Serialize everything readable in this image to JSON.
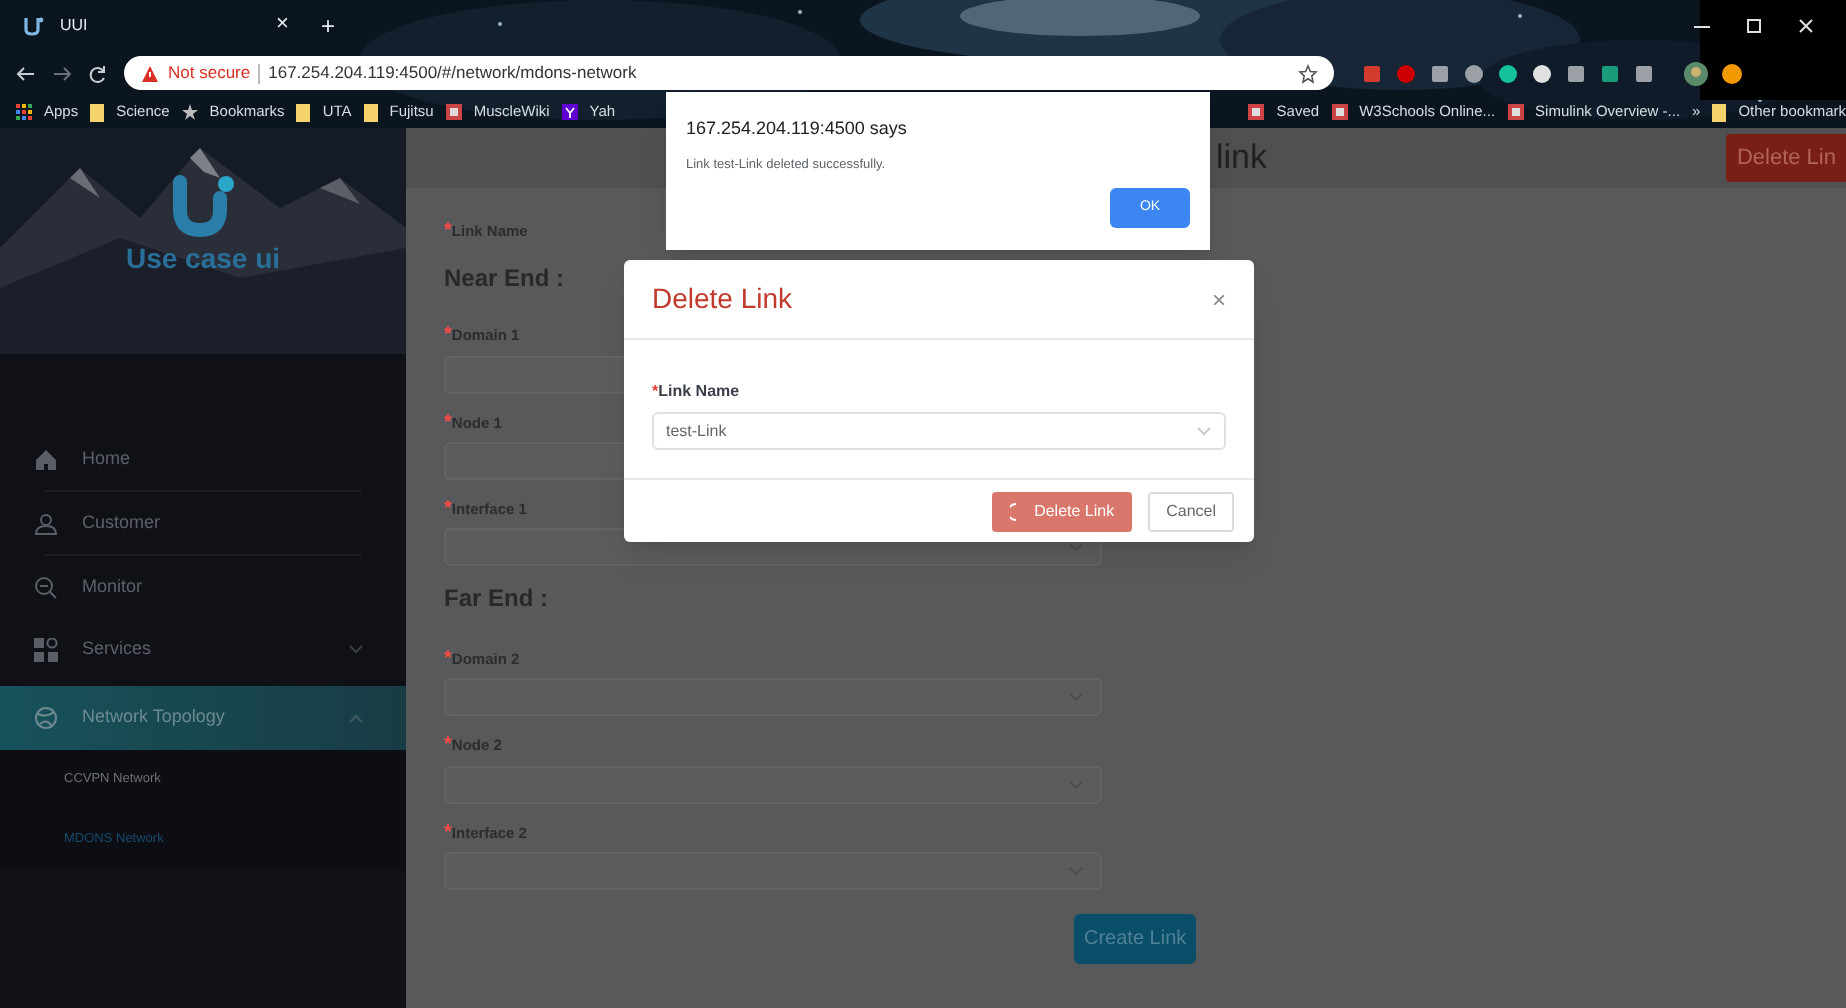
{
  "browser": {
    "tab": {
      "title": "UUI",
      "close": "×",
      "new_tab": "+"
    },
    "address": {
      "security": "Not secure",
      "url": "167.254.204.119:4500/#/network/mdons-network"
    },
    "bookmarks_left": [
      {
        "kind": "apps",
        "label": "Apps"
      },
      {
        "kind": "folder",
        "label": "Science"
      },
      {
        "kind": "star",
        "label": "Bookmarks"
      },
      {
        "kind": "folder",
        "label": "UTA"
      },
      {
        "kind": "folder",
        "label": "Fujitsu"
      },
      {
        "kind": "site",
        "label": "MuscleWiki"
      },
      {
        "kind": "yahoo",
        "label": "Yah"
      }
    ],
    "bookmarks_right": [
      {
        "kind": "site",
        "label": "Saved"
      },
      {
        "kind": "site",
        "label": "W3Schools Online..."
      },
      {
        "kind": "site",
        "label": "Simulink Overview -..."
      },
      {
        "kind": "more",
        "label": "»"
      },
      {
        "kind": "folder",
        "label": "Other bookmark"
      }
    ]
  },
  "sidebar": {
    "logo_text": "Use case ui",
    "menu": [
      {
        "kind": "home",
        "label": "Home",
        "selected": false
      },
      {
        "kind": "customer",
        "label": "Customer",
        "selected": false
      },
      {
        "kind": "monitor",
        "label": "Monitor",
        "selected": false
      },
      {
        "kind": "services",
        "label": "Services",
        "selected": false,
        "expanded": false
      },
      {
        "kind": "network",
        "label": "Network Topology",
        "selected": true,
        "expanded": true,
        "children": [
          {
            "label": "CCVPN Network",
            "selected": false
          },
          {
            "label": "MDONS Network",
            "selected": true
          }
        ]
      }
    ]
  },
  "header": {
    "title": "link",
    "button": "Delete Lin"
  },
  "form": {
    "link_name": {
      "marker": "*",
      "label": "Link Name"
    },
    "sections": [
      {
        "heading": "Near End :",
        "fields": [
          {
            "marker": "*",
            "label": "Domain 1"
          },
          {
            "marker": "*",
            "label": "Node 1"
          },
          {
            "marker": "*",
            "label": "Interface 1"
          }
        ]
      },
      {
        "heading": "Far End :",
        "fields": [
          {
            "marker": "*",
            "label": "Domain 2"
          },
          {
            "marker": "*",
            "label": "Node 2"
          },
          {
            "marker": "*",
            "label": "Interface 2"
          }
        ]
      }
    ],
    "submit": "Create Link"
  },
  "modal": {
    "title": "Delete Link",
    "close": "×",
    "field": {
      "marker": "*",
      "label": "Link Name",
      "value": "test-Link"
    },
    "buttons": [
      {
        "kind": "danger",
        "label": "Delete Link",
        "loading": true
      },
      {
        "kind": "default",
        "label": "Cancel",
        "loading": false
      }
    ]
  },
  "alert": {
    "origin": "167.254.204.119:4500 says",
    "message": "Link test-Link deleted successfully.",
    "button": "OK"
  }
}
